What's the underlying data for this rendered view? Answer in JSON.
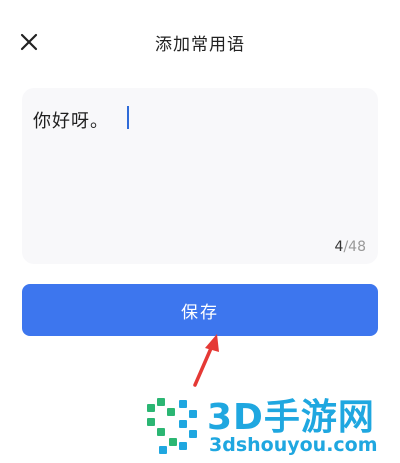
{
  "header": {
    "title": "添加常用语",
    "close_icon": "close-icon"
  },
  "editor": {
    "text": "你好呀。",
    "char_count_current": "4",
    "char_count_separator": "/",
    "char_count_max": "48"
  },
  "actions": {
    "save_label": "保存"
  },
  "watermark": {
    "brand": "3D手游网",
    "domain": "3dshouyou.com"
  },
  "colors": {
    "accent": "#3d76ee",
    "caret": "#2f6bd8",
    "annotation_arrow": "#e53935",
    "watermark": "#1fa7e0"
  }
}
